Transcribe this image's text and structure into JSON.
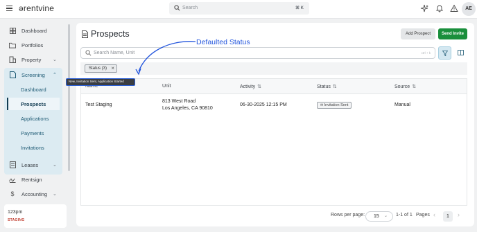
{
  "topbar": {
    "logo": "ərentvine",
    "search_placeholder": "Search",
    "search_shortcut": "⌘ K",
    "avatar_initials": "AE",
    "icons": [
      "sparkle-icon",
      "bell-icon",
      "alert-icon"
    ]
  },
  "sidebar": {
    "items": [
      {
        "label": "Dashboard",
        "icon": "dashboard-icon"
      },
      {
        "label": "Portfolios",
        "icon": "folder-icon"
      },
      {
        "label": "Property",
        "icon": "building-icon"
      },
      {
        "label": "Screening",
        "icon": "document-icon"
      },
      {
        "label": "Leases",
        "icon": "lease-icon"
      },
      {
        "label": "Rentsign",
        "icon": "signature-icon"
      },
      {
        "label": "Accounting",
        "icon": "dollar-icon"
      }
    ],
    "screening_sub": [
      "Dashboard",
      "Prospects",
      "Applications",
      "Payments",
      "Invitations"
    ],
    "active_sub": "Prospects",
    "org": {
      "name": "123pm",
      "environment": "STAGING"
    }
  },
  "page": {
    "title": "Prospects",
    "add_button": "Add Prospect",
    "send_button": "Send Invite",
    "search_placeholder": "Search Name, Unit",
    "search_shortcut": "ctrl + k",
    "filter_chip": "Status (3)",
    "tooltip": "New, Invitation Sent, Application Started",
    "annotation": "Defaulted Status"
  },
  "table": {
    "columns": [
      "Name",
      "Unit",
      "Activity",
      "Status",
      "Source"
    ],
    "rows": [
      {
        "name": "Test Staging",
        "unit_line1": "813 West Road",
        "unit_line2": "Los Angeles, CA 90810",
        "activity": "06-30-2025 12:15 PM",
        "status": "Invitation Sent",
        "source": "Manual"
      }
    ]
  },
  "pagination": {
    "rows_per_page_label": "Rows per page:",
    "rows_per_page": "15",
    "range": "1-1 of 1",
    "pages_label": "Pages",
    "current_page": "1"
  },
  "colors": {
    "accent": "#1a8f3c",
    "screening_bg": "#dcebf2",
    "annotation": "#2255dd",
    "staging": "#c0392b"
  }
}
